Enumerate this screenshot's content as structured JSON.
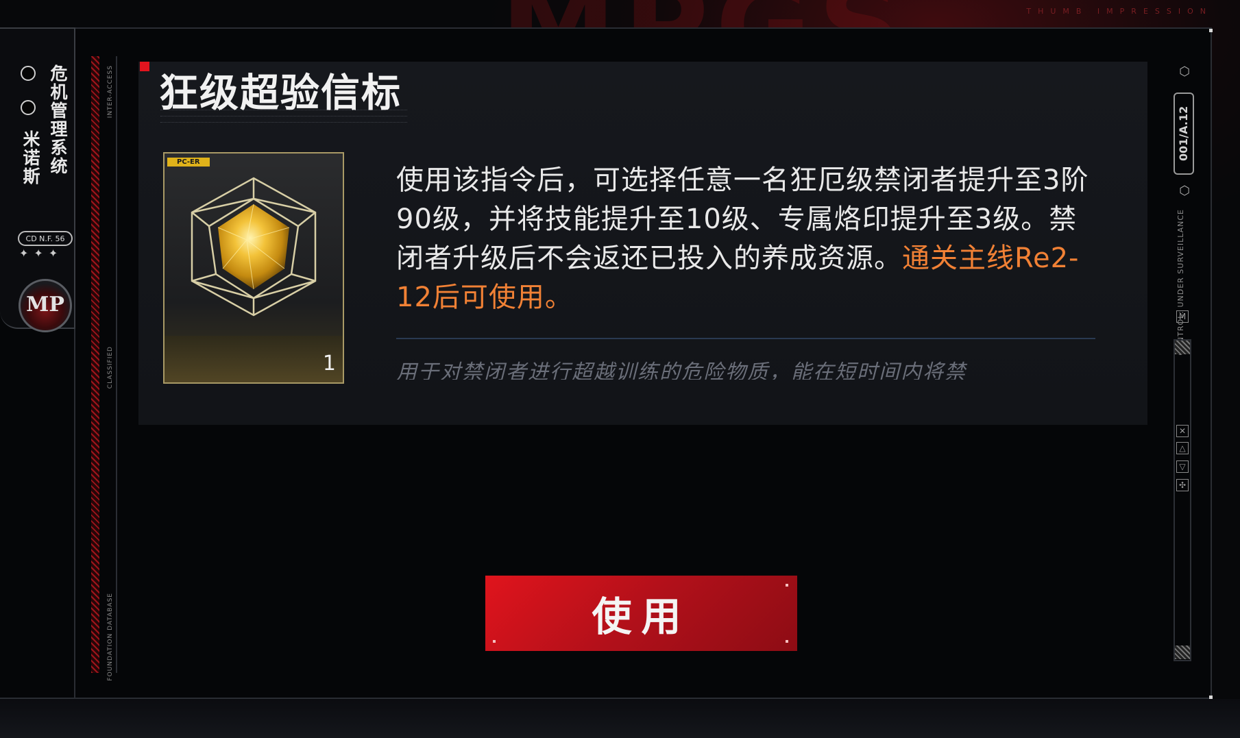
{
  "background": {
    "watermark_text": "MPGS",
    "top_caption": "THUMB IMPRESSION"
  },
  "left_tab": {
    "title_line1": "米诺斯",
    "title_line2": "危机管理系统",
    "code_badge": "CD N.F. 56",
    "stars": "✦✦✦",
    "emblem_text": "MP"
  },
  "side_labels": {
    "top": "INTER-ACCESS",
    "middle": "CLASSIFIED",
    "bottom": "FOUNDATION DATABASE",
    "right": "CONTROL: UNDER SURVEILLANCE"
  },
  "item": {
    "name": "狂级超验信标",
    "tag": "PC-ER",
    "count": "1",
    "description_main": "使用该指令后，可选择任意一名狂厄级禁闭者提升至3阶90级，并将技能提升至10级、专属烙印提升至3级。禁闭者升级后不会返还已投入的养成资源。",
    "description_highlight": "通关主线Re2-12后可使用。",
    "lore": "用于对禁闭者进行超越训练的危险物质，能在短时间内将禁"
  },
  "actions": {
    "use_label": "使用"
  },
  "right_panel": {
    "code": "001/A.12"
  },
  "colors": {
    "accent_red": "#e3141e",
    "highlight_orange": "#f18135",
    "gold": "#e0b21a"
  }
}
